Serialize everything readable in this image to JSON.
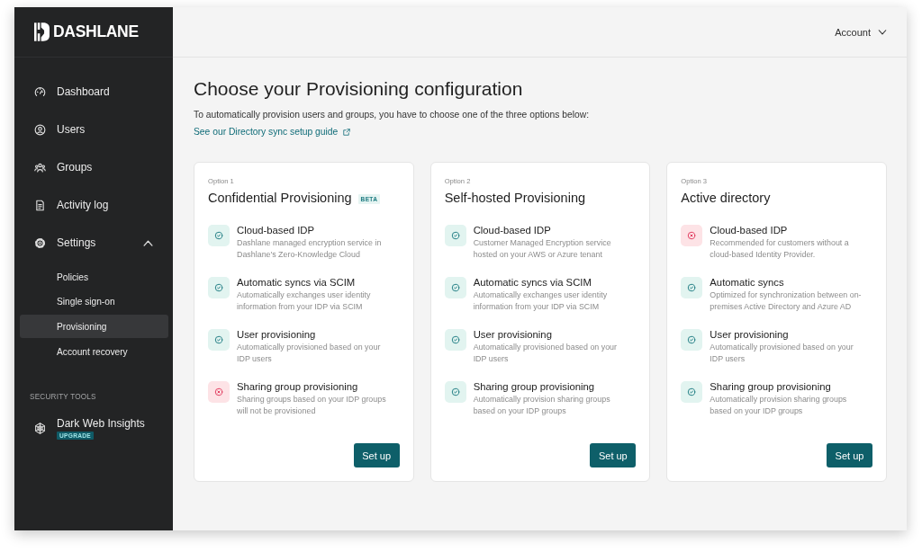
{
  "sidebar": {
    "brand": "DASHLANE",
    "items": [
      {
        "label": "Dashboard",
        "selected": false
      },
      {
        "label": "Users",
        "selected": false
      },
      {
        "label": "Groups",
        "selected": false
      },
      {
        "label": "Activity log",
        "selected": false
      },
      {
        "label": "Settings",
        "selected": false,
        "expanded": true,
        "children": [
          {
            "label": "Policies",
            "selected": false
          },
          {
            "label": "Single sign-on",
            "selected": false
          },
          {
            "label": "Provisioning",
            "selected": true
          },
          {
            "label": "Account recovery",
            "selected": false
          }
        ]
      }
    ],
    "sections": [
      {
        "heading": "SECURITY TOOLS",
        "items": [
          {
            "label": "Dark Web Insights",
            "badge": "UPGRADE",
            "selected": false
          }
        ]
      }
    ]
  },
  "header": {
    "account_menu": "Account"
  },
  "page": {
    "title": "Choose your Provisioning configuration",
    "intro": "To automatically provision users and groups, you have to choose one of the three options below:",
    "guide_link": "See our Directory sync setup guide"
  },
  "options": [
    {
      "option_label": "Option 1",
      "title": "Confidential Provisioning",
      "badge": "BETA",
      "features": [
        {
          "name": "Cloud-based IDP",
          "description": "Dashlane managed encryption service in Dashlane's Zero-Knowledge Cloud",
          "included": true
        },
        {
          "name": "Automatic syncs via SCIM",
          "description": "Automatically exchanges user identity information from your IDP via SCIM",
          "included": true
        },
        {
          "name": "User provisioning",
          "description": "Automatically provisioned based on your IDP users",
          "included": true
        },
        {
          "name": "Sharing group provisioning",
          "description": "Sharing groups based on your IDP groups will not be provisioned",
          "included": false
        }
      ],
      "button": "Set up"
    },
    {
      "option_label": "Option 2",
      "title": "Self-hosted Provisioning",
      "features": [
        {
          "name": "Cloud-based IDP",
          "description": "Customer Managed Encryption service hosted on your AWS or Azure tenant",
          "included": true
        },
        {
          "name": "Automatic syncs via SCIM",
          "description": "Automatically exchanges user identity information from your IDP via SCIM",
          "included": true
        },
        {
          "name": "User provisioning",
          "description": "Automatically provisioned based on your IDP users",
          "included": true
        },
        {
          "name": "Sharing group provisioning",
          "description": "Automatically provision sharing groups based on your IDP groups",
          "included": true
        }
      ],
      "button": "Set up"
    },
    {
      "option_label": "Option 3",
      "title": "Active directory",
      "features": [
        {
          "name": "Cloud-based IDP",
          "description": "Recommended for customers without a cloud-based Identity Provider.",
          "included": false
        },
        {
          "name": "Automatic syncs",
          "description": "Optimized for synchronization between on-premises Active Directory and Azure AD",
          "included": true
        },
        {
          "name": "User provisioning",
          "description": "Automatically provisioned based on your IDP users",
          "included": true
        },
        {
          "name": "Sharing group provisioning",
          "description": "Automatically provision sharing groups based on your IDP groups",
          "included": true
        }
      ],
      "button": "Set up"
    }
  ]
}
